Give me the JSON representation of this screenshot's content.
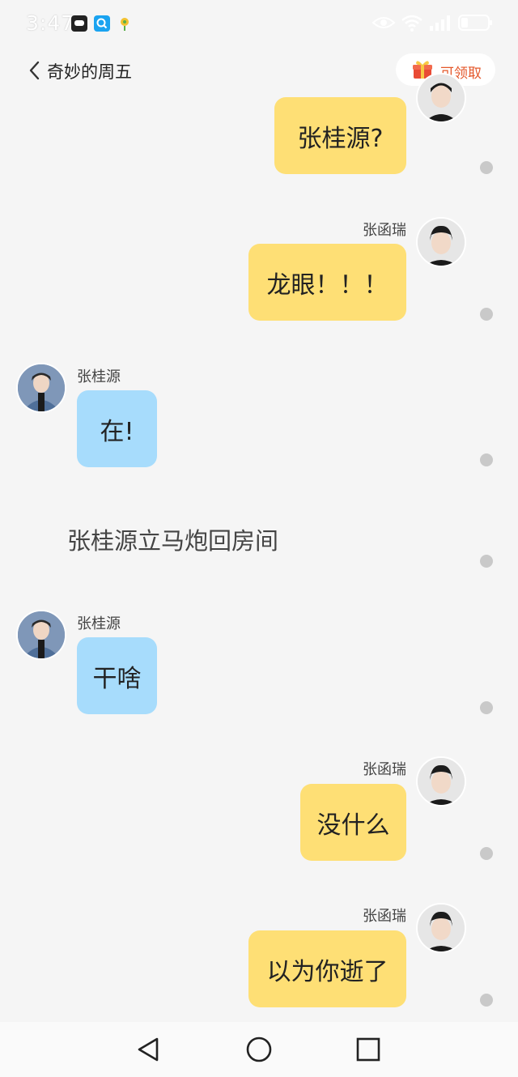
{
  "status_bar": {
    "time": "3:47",
    "notification_icons": [
      "beard-app-icon",
      "search-app-icon",
      "flower-app-icon"
    ],
    "status_icons": [
      "eye-icon",
      "wifi-icon",
      "signal-icon",
      "battery-icon"
    ]
  },
  "header": {
    "back_icon": "chevron-left-icon",
    "title": "奇妙的周五",
    "reward": {
      "icon": "gift-box-icon",
      "label": "可领取",
      "color": "#e4572a"
    }
  },
  "colors": {
    "right_bubble": "#fedf75",
    "left_bubble": "#a7dcfc",
    "background": "#f5f5f5"
  },
  "messages": [
    {
      "side": "right",
      "sender": "",
      "text": "张桂源?"
    },
    {
      "side": "right",
      "sender": "张函瑞",
      "text": "龙眼！！！"
    },
    {
      "side": "left",
      "sender": "张桂源",
      "text": "在!"
    },
    {
      "type": "narration",
      "text": "张桂源立马炮回房间"
    },
    {
      "side": "left",
      "sender": "张桂源",
      "text": "干啥"
    },
    {
      "side": "right",
      "sender": "张函瑞",
      "text": "没什么"
    },
    {
      "side": "right",
      "sender": "张函瑞",
      "text": "以为你逝了"
    }
  ],
  "nav_bar": {
    "icons": [
      "back-triangle-icon",
      "home-circle-icon",
      "recents-square-icon"
    ]
  }
}
